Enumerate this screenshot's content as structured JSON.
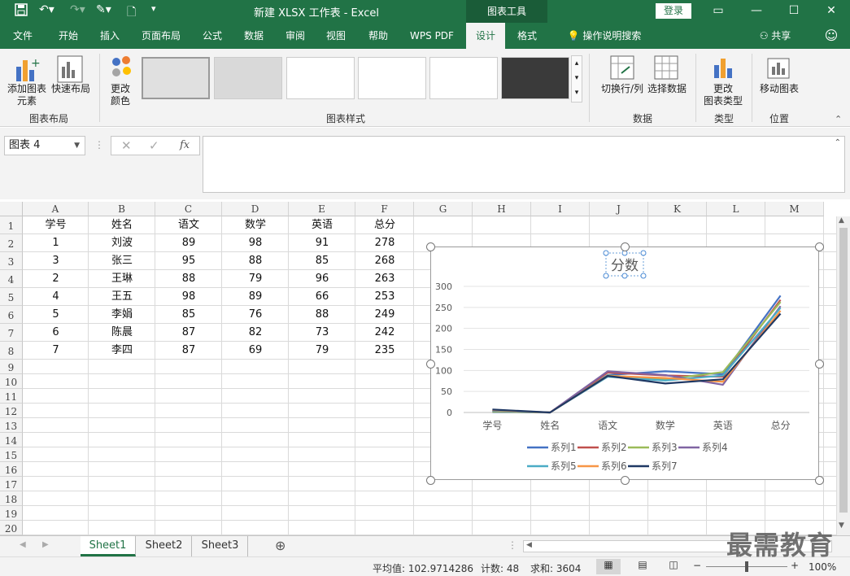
{
  "titlebar": {
    "title": "新建 XLSX 工作表  -  Excel",
    "chart_tools": "图表工具",
    "login": "登录"
  },
  "tabs": [
    "文件",
    "开始",
    "插入",
    "页面布局",
    "公式",
    "数据",
    "审阅",
    "视图",
    "帮助",
    "WPS PDF",
    "设计",
    "格式"
  ],
  "active_tab": "设计",
  "tell_me": "操作说明搜索",
  "share": "共享",
  "ribbon": {
    "add_element": "添加图表\n元素",
    "quick_layout": "快速布局",
    "change_color": "更改\n颜色",
    "group_layout": "图表布局",
    "group_styles": "图表样式",
    "switch_rowcol": "切换行/列",
    "select_data": "选择数据",
    "group_data": "数据",
    "change_type": "更改\n图表类型",
    "group_type": "类型",
    "move_chart": "移动图表",
    "group_location": "位置"
  },
  "namebox": "图表 4",
  "columns": [
    "A",
    "B",
    "C",
    "D",
    "E",
    "F",
    "G",
    "H",
    "I",
    "J",
    "K",
    "L",
    "M"
  ],
  "rows": [
    "1",
    "2",
    "3",
    "4",
    "5",
    "6",
    "7",
    "8",
    "9",
    "10",
    "11",
    "12",
    "13",
    "14",
    "15",
    "16",
    "17",
    "18",
    "19",
    "20"
  ],
  "table": {
    "headers": [
      "学号",
      "姓名",
      "语文",
      "数学",
      "英语",
      "总分"
    ],
    "data": [
      [
        "1",
        "刘波",
        "89",
        "98",
        "91",
        "278"
      ],
      [
        "3",
        "张三",
        "95",
        "88",
        "85",
        "268"
      ],
      [
        "2",
        "王琳",
        "88",
        "79",
        "96",
        "263"
      ],
      [
        "4",
        "王五",
        "98",
        "89",
        "66",
        "253"
      ],
      [
        "5",
        "李娟",
        "85",
        "76",
        "88",
        "249"
      ],
      [
        "6",
        "陈晨",
        "87",
        "82",
        "73",
        "242"
      ],
      [
        "7",
        "李四",
        "87",
        "69",
        "79",
        "235"
      ]
    ]
  },
  "chart_data": {
    "type": "line",
    "title": "分数",
    "categories": [
      "学号",
      "姓名",
      "语文",
      "数学",
      "英语",
      "总分"
    ],
    "ylim": [
      0,
      300
    ],
    "yticks": [
      "0",
      "50",
      "100",
      "150",
      "200",
      "250",
      "300"
    ],
    "legend_position": "bottom",
    "series": [
      {
        "name": "系列1",
        "color": "#4472c4",
        "values": [
          1,
          0,
          89,
          98,
          91,
          278
        ]
      },
      {
        "name": "系列2",
        "color": "#c0504d",
        "values": [
          3,
          0,
          95,
          88,
          85,
          268
        ]
      },
      {
        "name": "系列3",
        "color": "#9bbb59",
        "values": [
          2,
          0,
          88,
          79,
          96,
          263
        ]
      },
      {
        "name": "系列4",
        "color": "#8064a2",
        "values": [
          4,
          0,
          98,
          89,
          66,
          253
        ]
      },
      {
        "name": "系列5",
        "color": "#4bacc6",
        "values": [
          5,
          0,
          85,
          76,
          88,
          249
        ]
      },
      {
        "name": "系列6",
        "color": "#f79646",
        "values": [
          6,
          0,
          87,
          82,
          73,
          242
        ]
      },
      {
        "name": "系列7",
        "color": "#1f3864",
        "values": [
          7,
          0,
          87,
          69,
          79,
          235
        ]
      }
    ]
  },
  "sheets": [
    "Sheet1",
    "Sheet2",
    "Sheet3"
  ],
  "active_sheet": "Sheet1",
  "status": {
    "average": "平均值: 102.9714286",
    "count": "计数: 48",
    "sum": "求和: 3604",
    "zoom": "100%"
  },
  "watermark": "最需教育",
  "colors": {
    "accent": "#217346"
  }
}
